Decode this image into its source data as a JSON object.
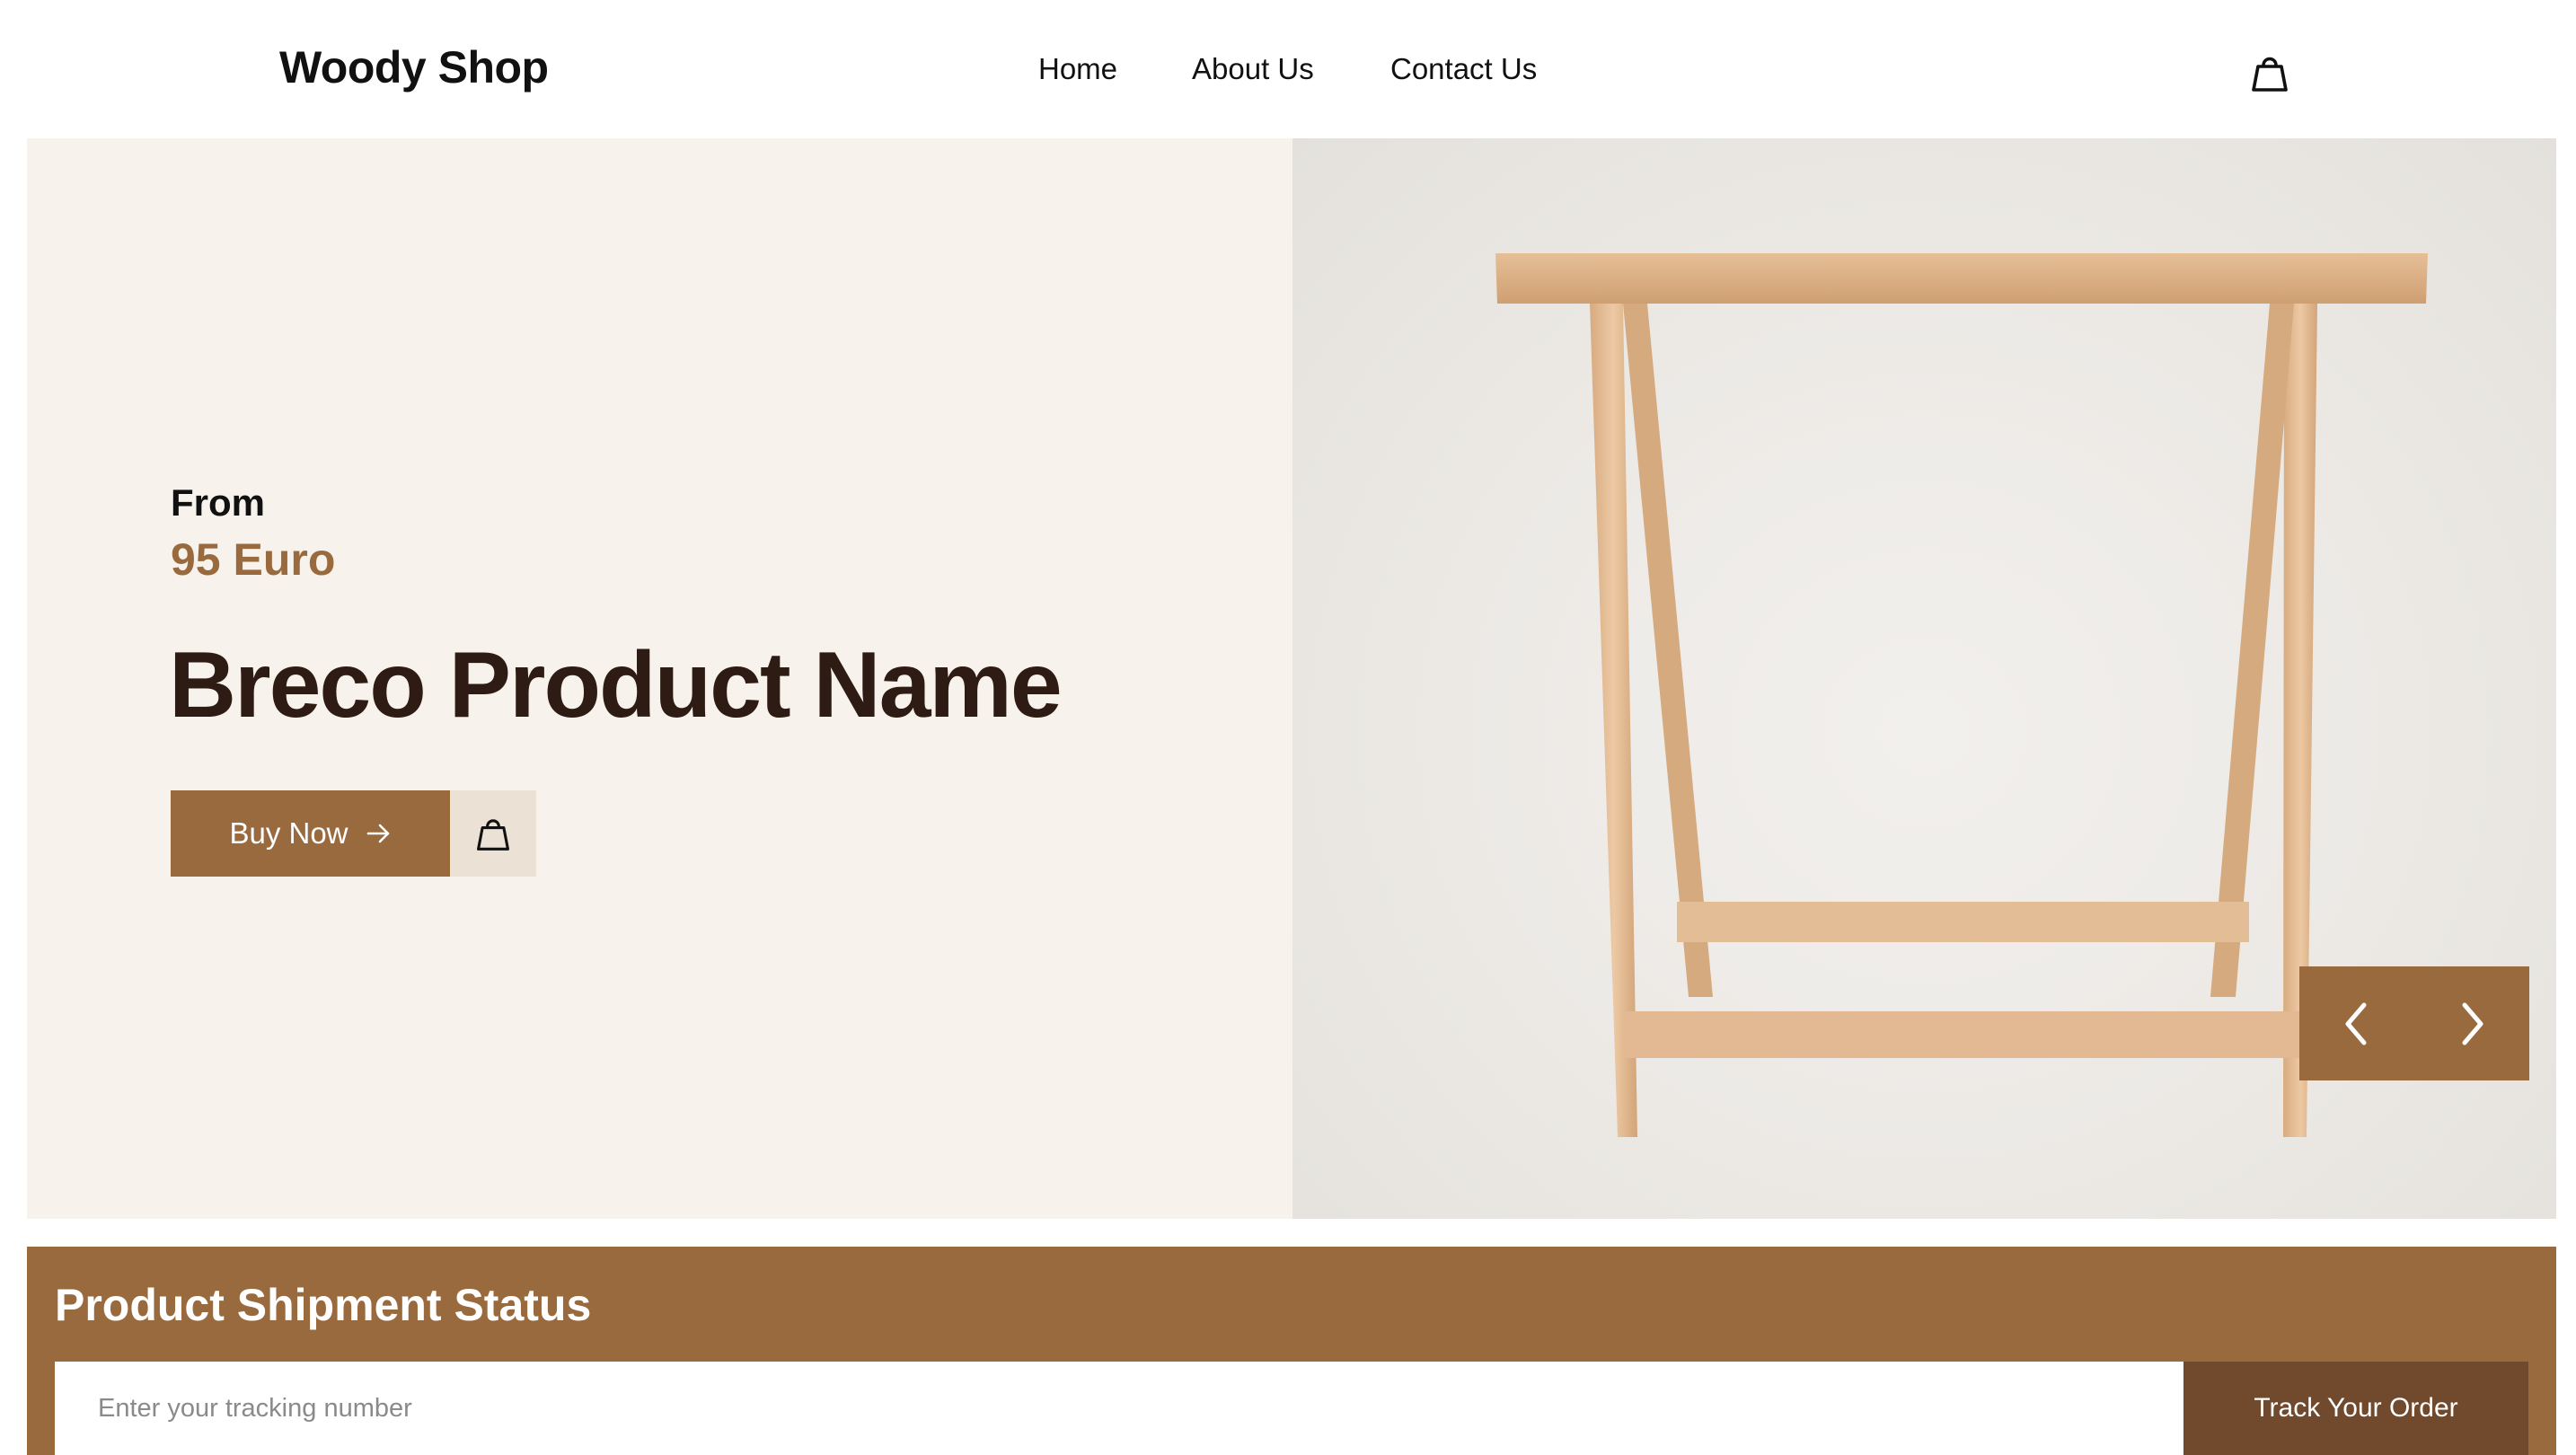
{
  "header": {
    "logo": "Woody Shop",
    "nav": [
      {
        "label": "Home"
      },
      {
        "label": "About Us"
      },
      {
        "label": "Contact Us"
      }
    ],
    "cart_icon": "shopping-bag-icon"
  },
  "hero": {
    "from_label": "From",
    "price": "95 Euro",
    "product_name": "Breco Product Name",
    "buy_button_label": "Buy Now",
    "buy_button_icon": "arrow-right-icon",
    "bag_button_icon": "shopping-bag-icon",
    "slider_prev_icon": "chevron-left-icon",
    "slider_next_icon": "chevron-right-icon"
  },
  "shipment": {
    "title": "Product Shipment Status",
    "input_placeholder": "Enter your tracking number",
    "input_value": "",
    "button_label": "Track Your Order"
  },
  "colors": {
    "accent": "#9a6a3f",
    "accent_dark": "#714a2e",
    "hero_bg": "#f7f3ec",
    "heading": "#2e1b14",
    "bag_button_bg": "#ece1d5"
  }
}
